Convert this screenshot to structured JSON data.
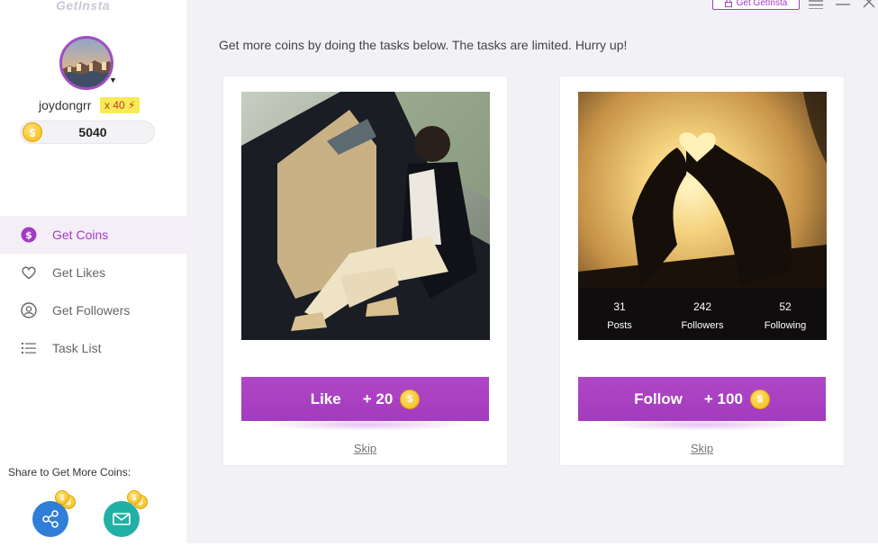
{
  "app": {
    "brand": "GetInsta"
  },
  "window": {
    "get_button_label": "Get GetInsta"
  },
  "profile": {
    "username": "joydongrr",
    "level": "x 40",
    "coins": "5040"
  },
  "nav": [
    {
      "label": "Get Coins",
      "icon": "dollar-icon",
      "active": true
    },
    {
      "label": "Get Likes",
      "icon": "heart-icon",
      "active": false
    },
    {
      "label": "Get Followers",
      "icon": "user-icon",
      "active": false
    },
    {
      "label": "Task List",
      "icon": "list-icon",
      "active": false
    }
  ],
  "share": {
    "label": "Share to Get More Coins:"
  },
  "main": {
    "instruction": "Get more coins by doing the tasks below. The tasks are limited. Hurry up!",
    "cards": [
      {
        "action_label": "Like",
        "reward": "+ 20",
        "skip": "Skip"
      },
      {
        "action_label": "Follow",
        "reward": "+ 100",
        "skip": "Skip",
        "stats": [
          {
            "value": "31",
            "label": "Posts"
          },
          {
            "value": "242",
            "label": "Followers"
          },
          {
            "value": "52",
            "label": "Following"
          }
        ]
      }
    ]
  },
  "colors": {
    "accent": "#a23cc4",
    "coin": "#f3b80d",
    "share_blue": "#2f7ed8",
    "share_teal": "#21b0a5"
  }
}
